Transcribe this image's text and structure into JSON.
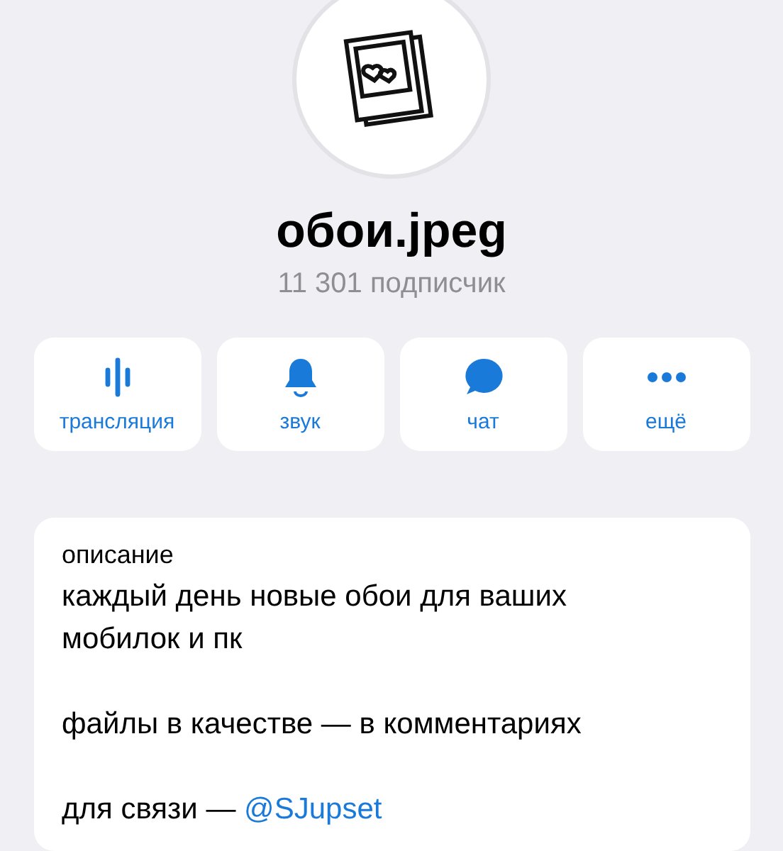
{
  "channel": {
    "name": "обои.jpeg",
    "subscribers": "11 301 подписчик"
  },
  "actions": [
    {
      "kind": "broadcast",
      "label": "трансляция"
    },
    {
      "kind": "sound",
      "label": "звук"
    },
    {
      "kind": "chat",
      "label": "чат"
    },
    {
      "kind": "more",
      "label": "ещё"
    }
  ],
  "description": {
    "label": "описание",
    "paragraphs": [
      "каждый день новые обои для ваших мобилок и пк",
      "файлы в качестве — в комментариях"
    ],
    "contact": {
      "prefix": "для связи —",
      "link": "@SJupset"
    }
  }
}
